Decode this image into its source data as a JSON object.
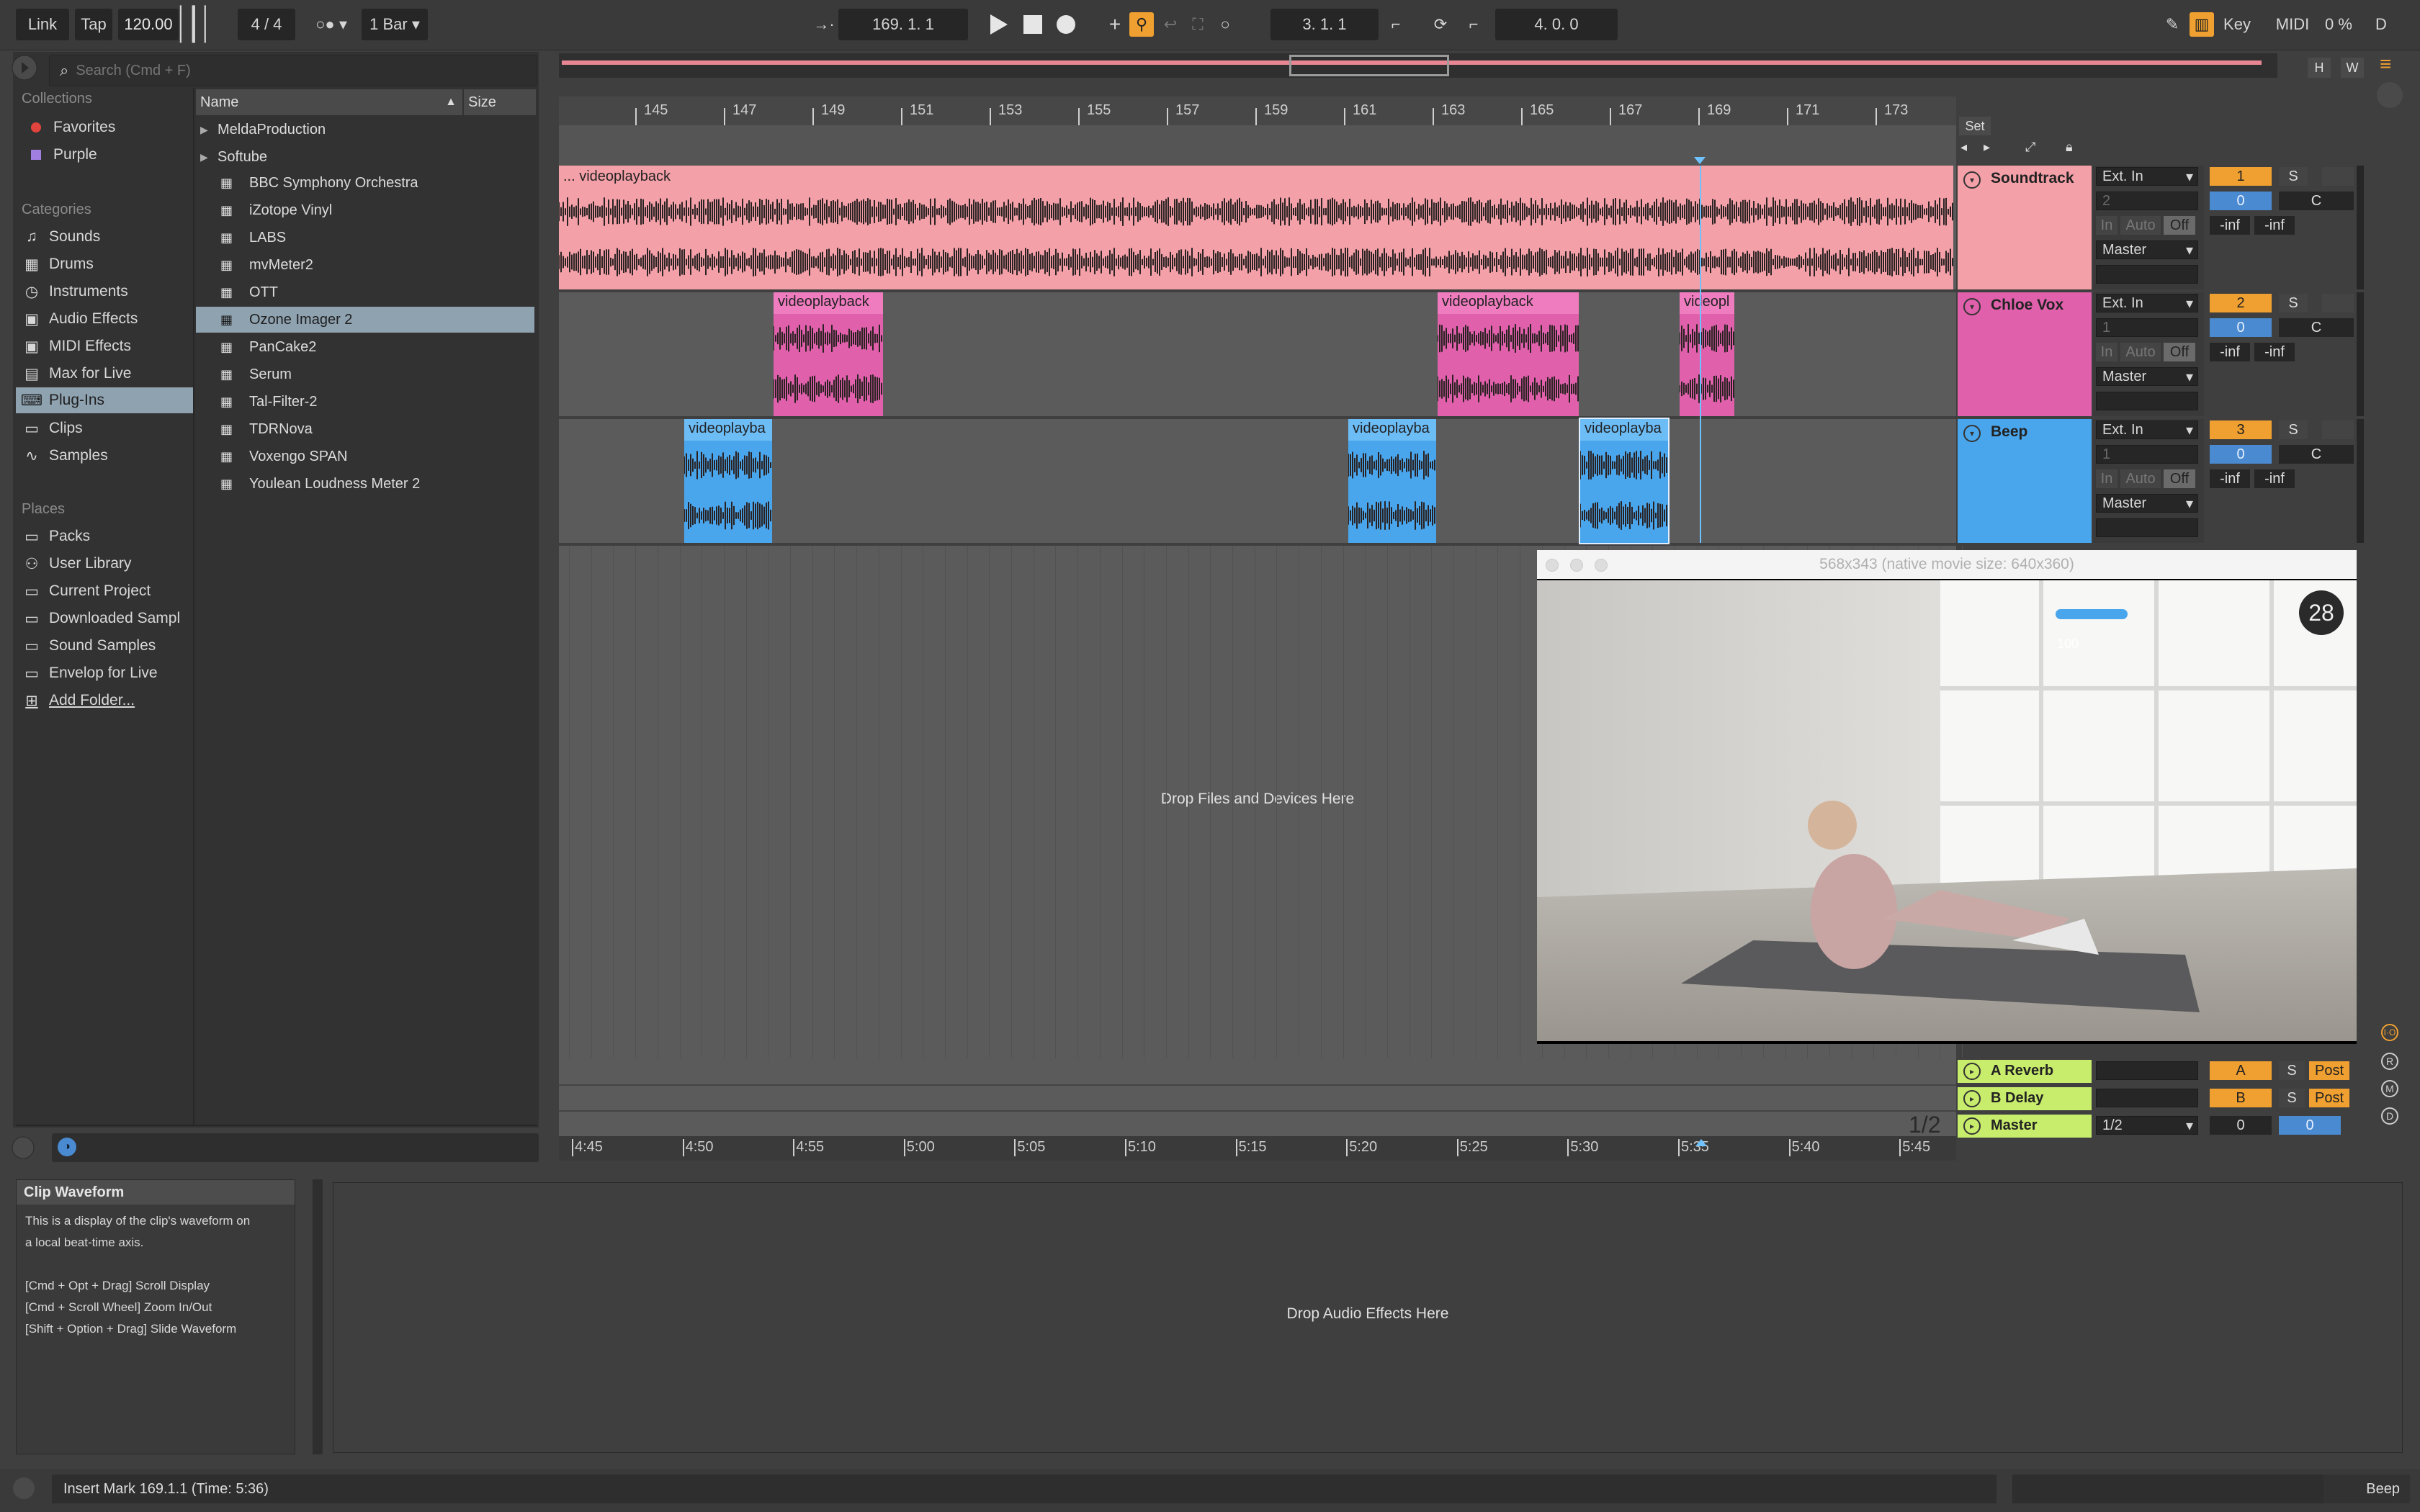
{
  "transport": {
    "link": "Link",
    "tap": "Tap",
    "tempo": "120.00",
    "sig": "4 / 4",
    "quant": "1 Bar",
    "pos": "169.  1.  1",
    "loop_start": "3.  1.  1",
    "loop_len": "4.  0.  0",
    "key": "Key",
    "midi": "MIDI",
    "cpu": "0 %",
    "d": "D"
  },
  "browser": {
    "search_placeholder": "Search (Cmd + F)",
    "collections_head": "Collections",
    "collections": [
      "Favorites",
      "Purple"
    ],
    "collection_colors": [
      "#e0443c",
      "#a07fe0"
    ],
    "categories_head": "Categories",
    "categories": [
      "Sounds",
      "Drums",
      "Instruments",
      "Audio Effects",
      "MIDI Effects",
      "Max for Live",
      "Plug-Ins",
      "Clips",
      "Samples"
    ],
    "places_head": "Places",
    "places": [
      "Packs",
      "User Library",
      "Current Project",
      "Downloaded Sampl",
      "Sound Samples",
      "Envelop for Live",
      "Add Folder..."
    ],
    "col_name": "Name",
    "col_size": "Size",
    "folders": [
      "MeldaProduction",
      "Softube"
    ],
    "files": [
      "BBC Symphony Orchestra",
      "iZotope Vinyl",
      "LABS",
      "mvMeter2",
      "OTT",
      "Ozone Imager 2",
      "PanCake2",
      "Serum",
      "Tal-Filter-2",
      "TDRNova",
      "Voxengo SPAN",
      "Youlean Loudness Meter 2"
    ],
    "selected_file": "Ozone Imager 2"
  },
  "ruler": {
    "bars": [
      "145",
      "147",
      "149",
      "151",
      "153",
      "155",
      "157",
      "159",
      "161",
      "163",
      "165",
      "167",
      "169",
      "171",
      "173"
    ],
    "set": "Set",
    "hw": [
      "H",
      "W"
    ]
  },
  "timeruler": [
    "4:45",
    "4:50",
    "4:55",
    "5:00",
    "5:05",
    "5:10",
    "5:15",
    "5:20",
    "5:25",
    "5:30",
    "5:35",
    "5:40",
    "5:45"
  ],
  "tracks": [
    {
      "name": "Soundtrack",
      "color": "#f4a0a8",
      "input": "Ext. In",
      "chan": "2",
      "out": "Master",
      "num": "1",
      "vol": "0",
      "pan": "C",
      "peak1": "-inf",
      "peak2": "-inf"
    },
    {
      "name": "Chloe Vox",
      "color": "#e060ac",
      "input": "Ext. In",
      "chan": "1",
      "out": "Master",
      "num": "2",
      "vol": "0",
      "pan": "C",
      "peak1": "-inf",
      "peak2": "-inf"
    },
    {
      "name": "Beep",
      "color": "#4aa6ec",
      "input": "Ext. In",
      "chan": "1",
      "out": "Master",
      "num": "3",
      "vol": "0",
      "pan": "C",
      "peak1": "-inf",
      "peak2": "-inf"
    }
  ],
  "track_btn": {
    "solo": "S",
    "in": "In",
    "auto": "Auto",
    "off": "Off"
  },
  "clips": {
    "main": "... videoplayback",
    "c": "videoplayback",
    "c_short": "videopl",
    "c_beep": "videoplayba"
  },
  "returns": [
    {
      "name": "A Reverb",
      "letter": "A",
      "post": "Post"
    },
    {
      "name": "B Delay",
      "letter": "B",
      "post": "Post"
    },
    {
      "name": "Master",
      "letter": "1/2"
    }
  ],
  "master": {
    "vol": "0",
    "pan": "0"
  },
  "drop_files": "Drop Files and Devices Here",
  "page": "1/2",
  "video": {
    "title": "568x343 (native movie size: 640x360)",
    "counter": "28",
    "hud": "100"
  },
  "info": {
    "title": "Clip Waveform",
    "lines": [
      "This is a display of the clip's waveform on",
      "a local beat-time axis.",
      "",
      "[Cmd + Opt + Drag] Scroll Display",
      "[Cmd + Scroll Wheel] Zoom In/Out",
      "[Shift + Option + Drag] Slide Waveform"
    ]
  },
  "device_drop": "Drop Audio Effects Here",
  "status": {
    "text": "Insert Mark 169.1.1 (Time: 5:36)",
    "track": "Beep"
  }
}
